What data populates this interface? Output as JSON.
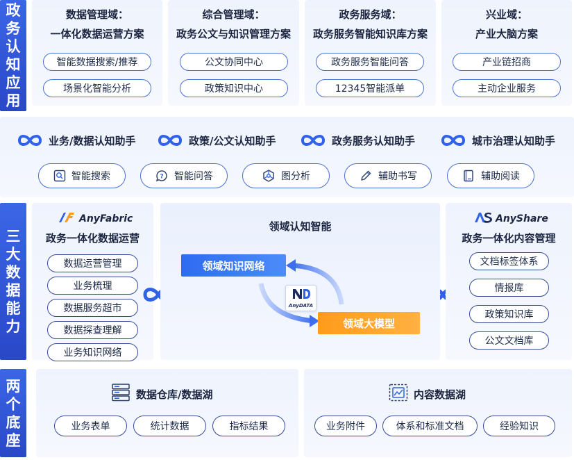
{
  "bands": {
    "top": [
      "政",
      "务",
      "认",
      "知",
      "应",
      "用"
    ],
    "middle": [
      "三",
      "大",
      "数",
      "据",
      "能",
      "力"
    ],
    "bottom": [
      "两",
      "个",
      "底",
      "座"
    ]
  },
  "domains": [
    {
      "title1": "数据管理域：",
      "title2": "一体化数据运营方案",
      "items": [
        "智能数据搜索/推荐",
        "场景化智能分析"
      ]
    },
    {
      "title1": "综合管理域：",
      "title2": "政务公文与知识管理方案",
      "items": [
        "公文协同中心",
        "政策知识中心"
      ]
    },
    {
      "title1": "政务服务域：",
      "title2": "政务服务智能知识库方案",
      "items": [
        "政务服务智能问答",
        "12345智能派单"
      ]
    },
    {
      "title1": "兴业域：",
      "title2": "产业大脑方案",
      "items": [
        "产业链招商",
        "主动企业服务"
      ]
    }
  ],
  "assistants": [
    "业务/数据认知助手",
    "政策/公文认知助手",
    "政务服务认知助手",
    "城市治理认知助手"
  ],
  "tools": [
    {
      "label": "智能搜索",
      "icon": "search-icon"
    },
    {
      "label": "智能问答",
      "icon": "chat-question-icon"
    },
    {
      "label": "图分析",
      "icon": "graph-icon"
    },
    {
      "label": "辅助书写",
      "icon": "pen-icon"
    },
    {
      "label": "辅助阅读",
      "icon": "book-icon"
    }
  ],
  "anyfabric": {
    "brand": "AnyFabric",
    "title": "政务一体化数据运营",
    "items": [
      "数据运营管理",
      "业务梳理",
      "数据服务超市",
      "数据探查理解",
      "业务知识网络"
    ]
  },
  "center": {
    "title": "领域认知智能",
    "network": "领域知识网络",
    "model": "领域大模型",
    "anydata": "AnyDATA"
  },
  "anyshare": {
    "brand": "AnyShare",
    "title": "政务一体化内容管理",
    "items": [
      "文档标签体系",
      "情报库",
      "政策知识库",
      "公文文档库"
    ]
  },
  "bases": [
    {
      "title": "数据仓库/数据湖",
      "icon": "server-icon",
      "items": [
        "业务表单",
        "统计数据",
        "指标结果"
      ]
    },
    {
      "title": "内容数据湖",
      "icon": "content-lake-icon",
      "items": [
        "业务附件",
        "体系和标准文档",
        "经验知识"
      ]
    }
  ],
  "colors": {
    "band": "#2948c8",
    "pill_border": "#4b6fd4",
    "blue_box": "#2f6bf0",
    "orange_box": "#ff9b1a",
    "panel_bg": "#eef3fd"
  }
}
